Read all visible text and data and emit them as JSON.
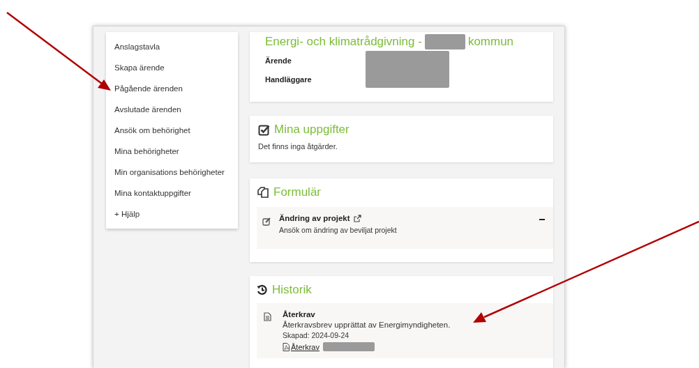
{
  "sidebar": {
    "items": [
      {
        "label": "Anslagstavla"
      },
      {
        "label": "Skapa ärende"
      },
      {
        "label": "Pågående ärenden"
      },
      {
        "label": "Avslutade ärenden"
      },
      {
        "label": "Ansök om behörighet"
      },
      {
        "label": "Mina behörigheter"
      },
      {
        "label": "Min organisations behörigheter"
      },
      {
        "label": "Mina kontaktuppgifter"
      },
      {
        "label": "+ Hjälp"
      }
    ]
  },
  "case_card": {
    "title_prefix": "Energi- och klimatrådgivning -",
    "title_suffix": "kommun",
    "fields": [
      {
        "label": "Ärende"
      },
      {
        "label": "Handläggare"
      }
    ]
  },
  "tasks": {
    "title": "Mina uppgifter",
    "message": "Det finns inga åtgärder."
  },
  "forms": {
    "title": "Formulär",
    "items": [
      {
        "title": "Ändring av projekt",
        "description": "Ansök om ändring av beviljat projekt",
        "expanded": true
      }
    ]
  },
  "history": {
    "title": "Historik",
    "items": [
      {
        "title": "Återkrav",
        "description": "Återkravsbrev upprättat av Energimyndigheten.",
        "created": "Skapad: 2024-09-24",
        "attachment": "Återkrav"
      }
    ]
  }
}
